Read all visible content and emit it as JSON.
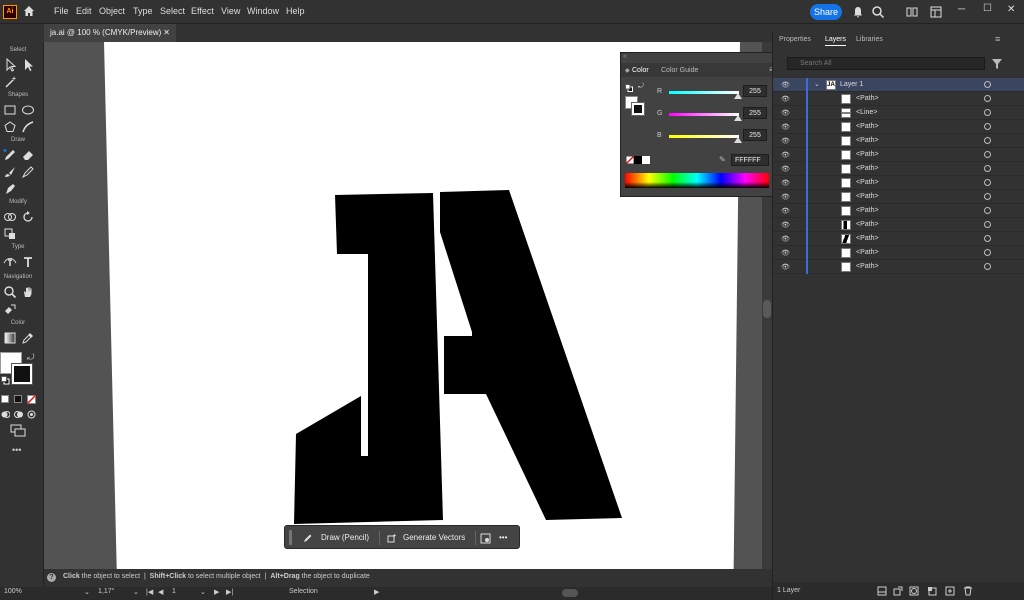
{
  "app": {
    "logo": "Ai",
    "menu": [
      "File",
      "Edit",
      "Object",
      "Type",
      "Select",
      "Effect",
      "View",
      "Window",
      "Help"
    ],
    "share_label": "Share"
  },
  "document": {
    "tab_title": "ja.ai @ 100 % (CMYK/Preview)",
    "close_glyph": "✕"
  },
  "toolbar": {
    "sections": [
      "Select",
      "Shapes",
      "Draw",
      "Modify",
      "Type",
      "Navigation",
      "Color"
    ],
    "more": "•••"
  },
  "context_bar": {
    "draw_label": "Draw (Pencil)",
    "vectors_label": "Generate Vectors",
    "more": "•••"
  },
  "status": {
    "click_bold": "Click",
    "click_text": " the object to select",
    "shift_bold": "Shift+Click",
    "shift_text": " to select multiple object",
    "alt_bold": "Alt+Drag",
    "alt_text": " the object to duplicate",
    "sep": "|"
  },
  "bottombar": {
    "zoom": "100%",
    "rotate": "1,17°",
    "artboard": "1",
    "tool": "Selection"
  },
  "panels": {
    "tabs": [
      "Properties",
      "Layers",
      "Libraries"
    ],
    "search_placeholder": "Search All",
    "layer_name": "Layer 1",
    "items": [
      "<Path>",
      "<Line>",
      "<Path>",
      "<Path>",
      "<Path>",
      "<Path>",
      "<Path>",
      "<Path>",
      "<Path>",
      "<Path>",
      "<Path>",
      "<Path>",
      "<Path>"
    ],
    "footer": "1 Layer"
  },
  "color": {
    "tabs": [
      "Color",
      "Color Guide"
    ],
    "channels": [
      {
        "name": "R",
        "value": "255"
      },
      {
        "name": "G",
        "value": "255"
      },
      {
        "name": "B",
        "value": "255"
      }
    ],
    "hex": "FFFFFF"
  }
}
